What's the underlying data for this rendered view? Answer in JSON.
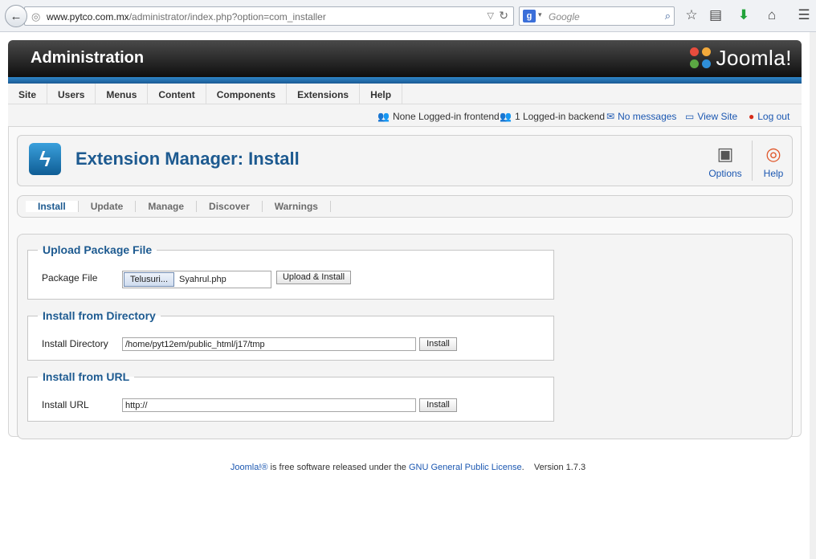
{
  "browser": {
    "url_domain": "www.pytco.com.mx",
    "url_path": "/administrator/index.php?option=com_installer",
    "search_placeholder": "Google"
  },
  "header": {
    "title": "Administration",
    "logo_text": "Joomla!"
  },
  "menu": [
    "Site",
    "Users",
    "Menus",
    "Content",
    "Components",
    "Extensions",
    "Help"
  ],
  "status": {
    "frontend": "None Logged-in frontend",
    "backend": "1 Logged-in backend",
    "messages": "No messages",
    "view_site": "View Site",
    "logout": "Log out"
  },
  "toolbar": {
    "page_title": "Extension Manager: Install",
    "options_label": "Options",
    "help_label": "Help"
  },
  "tabs": [
    "Install",
    "Update",
    "Manage",
    "Discover",
    "Warnings"
  ],
  "upload": {
    "legend": "Upload Package File",
    "label": "Package File",
    "browse_label": "Telusuri...",
    "file_name": "Syahrul.php",
    "button": "Upload & Install"
  },
  "directory": {
    "legend": "Install from Directory",
    "label": "Install Directory",
    "value": "/home/pyt12em/public_html/j17/tmp",
    "button": "Install"
  },
  "url_install": {
    "legend": "Install from URL",
    "label": "Install URL",
    "value": "http://",
    "button": "Install"
  },
  "footer": {
    "joomla": "Joomla!®",
    "text1": " is free software released under the ",
    "license": "GNU General Public License",
    "text2": ".",
    "version": "Version 1.7.3"
  },
  "colors": {
    "accent": "#1d5a90",
    "link": "#1b57b1",
    "header_dark": "#0f0f0f"
  }
}
